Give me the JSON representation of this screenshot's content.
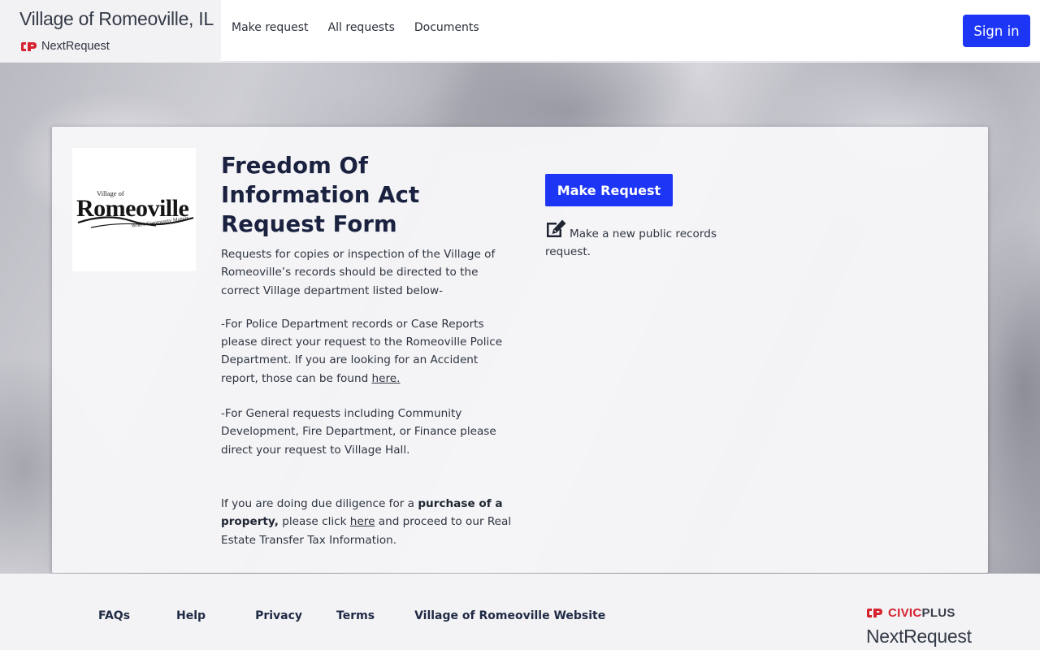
{
  "header": {
    "org_title": "Village of Romeoville, IL",
    "product_name": "NextRequest",
    "nav": [
      "Make request",
      "All requests",
      "Documents"
    ],
    "sign_in_label": "Sign in"
  },
  "card": {
    "logo": {
      "top_small": "Village of",
      "name": "Romeoville",
      "tagline": "Where Community Matters"
    },
    "title": "Freedom Of Information Act Request Form",
    "para1": "Requests for copies or inspection of the Village of Romeoville’s records should be directed to the correct Village department listed below-",
    "para2_text": "-For Police Department records or Case Reports please direct your request to the Romeoville Police Department. If you are looking for an Accident report, those can be found ",
    "para2_link": "here.",
    "para3": "-For General requests including Community Development, Fire Department, or Finance please direct your request to Village Hall.",
    "para4_before": "If you are doing due diligence for a ",
    "para4_bold": "purchase of a property,",
    "para4_mid": " please click ",
    "para4_link": "here",
    "para4_after": " and proceed to our Real Estate Transfer Tax Information.",
    "make_request_label": "Make Request",
    "make_request_desc": "Make a new public records request."
  },
  "footer": {
    "links": [
      "FAQs",
      "Help",
      "Privacy",
      "Terms",
      "Village of Romeoville Website"
    ],
    "civicplus_brand": "CIVICPLUS",
    "civicplus_brand_red": "CIVIC",
    "civicplus_brand_dark": "PLUS",
    "product_name": "NextRequest"
  },
  "colors": {
    "primary_button": "#1d35f5",
    "civicplus_red": "#d5232f",
    "heading": "#1b2240"
  },
  "icons": [
    "civicplus-logo-icon",
    "edit-icon"
  ]
}
